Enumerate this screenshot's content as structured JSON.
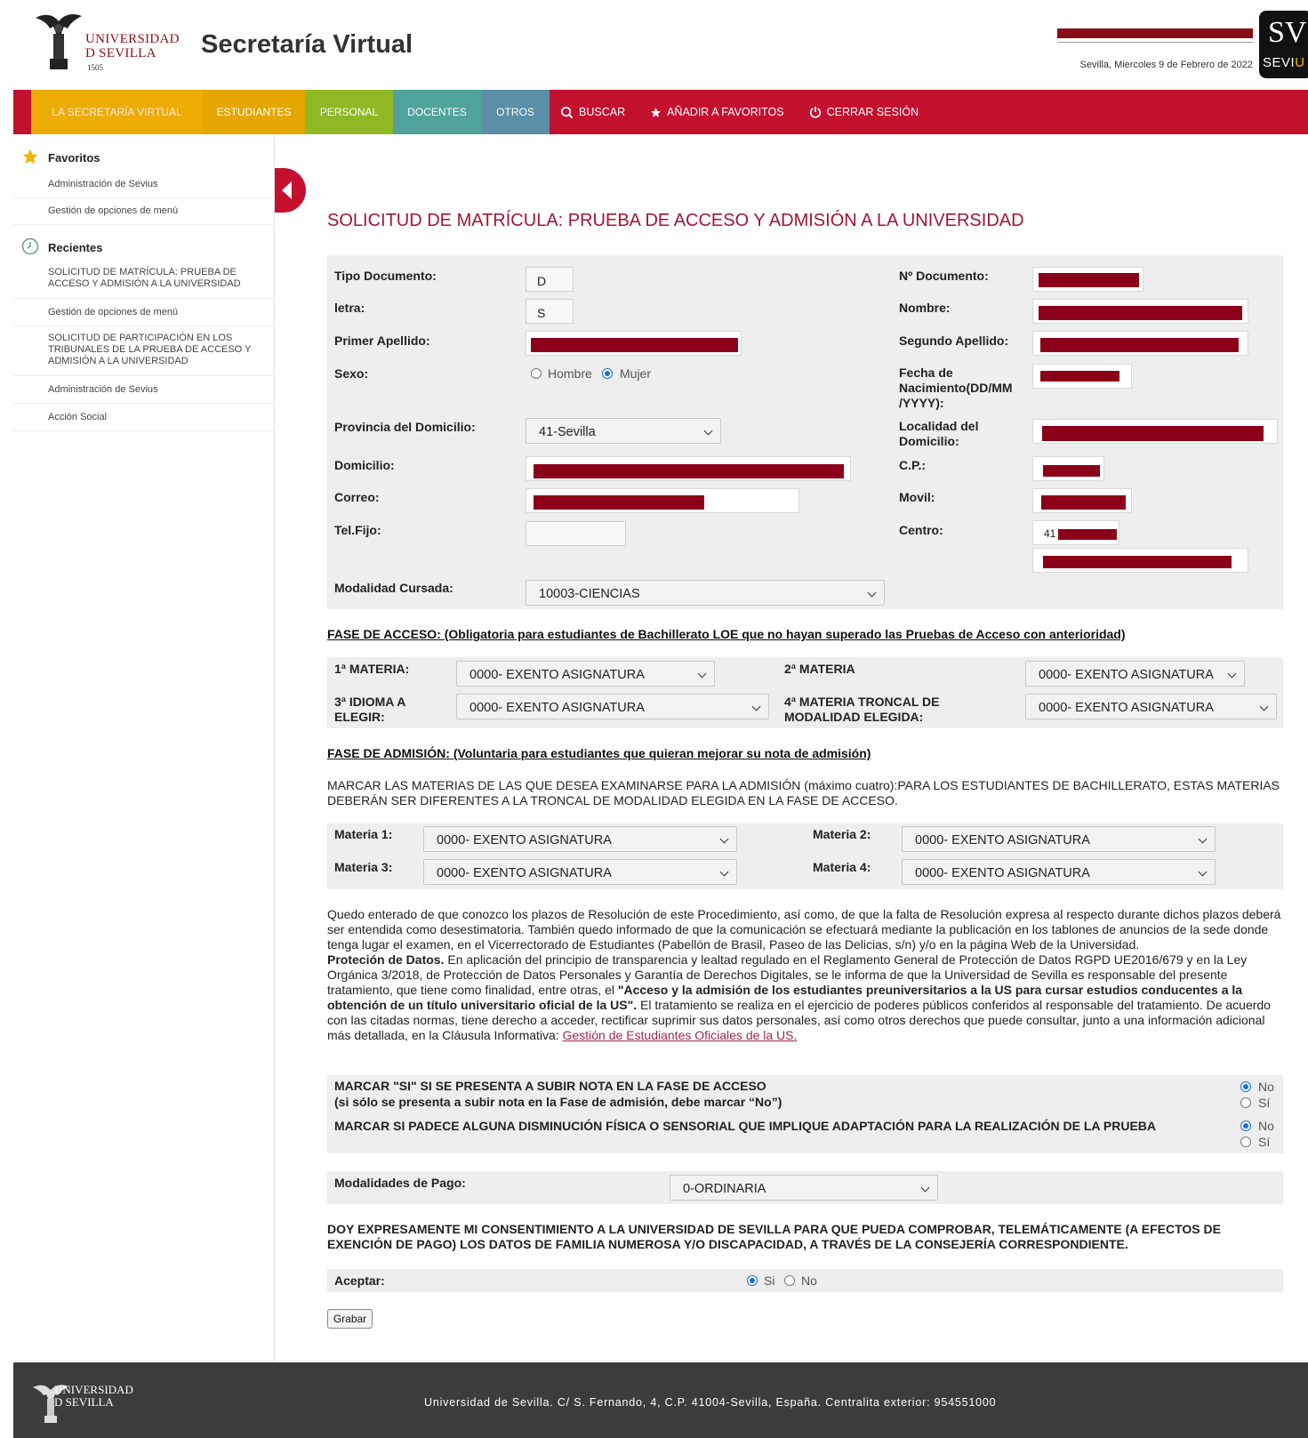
{
  "header": {
    "logo_line1": "UNIVERSIDAD",
    "logo_line2": "D SEVILLA",
    "logo_year": "1505",
    "app_title": "Secretaría Virtual",
    "date": "Sevilla, Miercoles 9 de Febrero de 2022",
    "badge_initials": "SV",
    "badge_word_a": "SEVI",
    "badge_word_b": "U"
  },
  "nav": {
    "tabs": [
      {
        "label": "LA SECRETARÍA VIRTUAL",
        "color": "#f2bd00"
      },
      {
        "label": "ESTUDIANTES",
        "color": "#e5a600"
      },
      {
        "label": "PERSONAL",
        "color": "#8fb824"
      },
      {
        "label": "DOCENTES",
        "color": "#50a39b"
      },
      {
        "label": "OTROS",
        "color": "#5b8ea7"
      }
    ],
    "search": "BUSCAR",
    "favorite": "AÑADIR A FAVORITOS",
    "logout": "CERRAR SESIÓN"
  },
  "sidebar": {
    "favorites_title": "Favoritos",
    "favorites": [
      "Administración de Sevius",
      "Gestión de opciones de menú"
    ],
    "recent_title": "Recientes",
    "recent": [
      "SOLICITUD DE MATRÍCULA: PRUEBA DE ACCESO Y ADMISIÓN A LA UNIVERSIDAD",
      "Gestión de opciones de menú",
      "SOLICITUD DE PARTICIPACIÓN EN LOS TRIBUNALES DE LA PRUEBA DE ACCESO Y ADMISIÓN A LA UNIVERSIDAD",
      "Administración de Sevius",
      "Acción Social"
    ]
  },
  "form": {
    "title": "SOLICITUD DE MATRÍCULA: PRUEBA DE ACCESO Y ADMISIÓN A LA UNIVERSIDAD",
    "labels": {
      "tipo_doc": "Tipo Documento:",
      "letra": "letra:",
      "primer_apellido": "Primer Apellido:",
      "sexo": "Sexo:",
      "provincia": "Provincia del Domicilio:",
      "domicilio": "Domicilio:",
      "correo": "Correo:",
      "telfijo": "Tel.Fijo:",
      "n_doc": "Nº Documento:",
      "nombre": "Nombre:",
      "segundo_apellido": "Segundo Apellido:",
      "fecha_nac": "Fecha de Nacimiento(DD/MM /YYYY):",
      "localidad": "Localidad del Domicilio:",
      "cp": "C.P.:",
      "movil": "Movil:",
      "centro": "Centro:",
      "modalidad": "Modalidad Cursada:"
    },
    "values": {
      "tipo_doc": "D",
      "letra": "S",
      "provincia": "41-Sevilla",
      "centro_prefix": "41",
      "modalidad": "10003-CIENCIAS"
    },
    "sexo_options": [
      "Hombre",
      "Mujer"
    ],
    "sexo_selected": "Mujer"
  },
  "acceso": {
    "heading": "FASE DE ACCESO: (Obligatoria para estudiantes de Bachillerato LOE que no hayan superado las Pruebas de Acceso con anterioridad)",
    "labels": [
      "1ª MATERIA:",
      "2ª MATERIA",
      "3ª IDIOMA A ELEGIR:",
      "4ª MATERIA TRONCAL DE MODALIDAD ELEGIDA:"
    ],
    "values": [
      "0000- EXENTO ASIGNATURA",
      "0000- EXENTO ASIGNATURA",
      "0000- EXENTO ASIGNATURA",
      "0000- EXENTO ASIGNATURA"
    ]
  },
  "admision": {
    "heading": "FASE DE ADMISIÓN: (Voluntaria para estudiantes que quieran mejorar su nota de admisión)",
    "instructions": "MARCAR LAS MATERIAS DE LAS QUE DESEA EXAMINARSE PARA LA ADMISIÓN (máximo cuatro):PARA LOS ESTUDIANTES DE BACHILLERATO, ESTAS MATERIAS DEBERÁN SER DIFERENTES A LA TRONCAL DE MODALIDAD ELEGIDA EN LA FASE DE ACCESO.",
    "labels": [
      "Materia 1:",
      "Materia 2:",
      "Materia 3:",
      "Materia 4:"
    ],
    "values": [
      "0000- EXENTO ASIGNATURA",
      "0000- EXENTO ASIGNATURA",
      "0000- EXENTO ASIGNATURA",
      "0000- EXENTO ASIGNATURA"
    ]
  },
  "legal": {
    "p1": "Quedo enterado de que conozco los plazos de Resolución de este Procedimiento, así como, de que la falta de Resolución expresa al respecto durante dichos plazos deberá ser entendida como desestimatoria. También quedo informado de que la comunicación se efectuará mediante la publicación en los tablones de anuncios de la sede donde tenga lugar el examen, en el Vicerrectorado de Estudiantes (Pabellón de Brasil, Paseo de las Delicias, s/n) y/o en la página Web de la Universidad.",
    "p2_bold": "Proteción de Datos.",
    "p2_a": " En aplicación del principio de transparencia y lealtad regulado en el Reglamento General de Protección de Datos RGPD UE2016/679 y en la Ley Orgánica 3/2018, de Protección de Datos Personales y Garantía de Derechos Digitales, se le informa de que la Universidad de Sevilla es responsable del presente tratamiento, que tiene como finalidad, entre otras, el ",
    "p2_bold2": "\"Acceso y la admisión de los estudiantes preuniversitarios a la US para cursar estudios conducentes a la obtención de un título universitario oficial de la US\".",
    "p2_b": " El tratamiento se realiza en el ejercicio de poderes públicos conferidos al responsable del tratamiento. De acuerdo con las citadas normas, tiene derecho a acceder, rectificar suprimir sus datos personales, así como otros derechos que puede consultar, junto a una información adicional más detallada, en la Cláusula Informativa: ",
    "link": "Gestión de Estudiantes Oficiales de la US."
  },
  "questions": {
    "q1": "MARCAR \"SI\" SI SE PRESENTA A SUBIR NOTA EN LA FASE DE ACCESO",
    "q1_sub": "(si sólo se presenta a subir nota en la Fase de admisión, debe marcar “No”)",
    "q2": "MARCAR SI PADECE ALGUNA DISMINUCIÓN FÍSICA O SENSORIAL QUE IMPLIQUE ADAPTACIÓN PARA LA REALIZACIÓN DE LA PRUEBA",
    "no": "No",
    "si": "Sí",
    "q1_selected": "No",
    "q2_selected": "No"
  },
  "pago": {
    "label": "Modalidades de Pago:",
    "value": "0-ORDINARIA"
  },
  "consent": {
    "text": "DOY EXPRESAMENTE MI CONSENTIMIENTO A LA UNIVERSIDAD DE SEVILLA PARA QUE PUEDA COMPROBAR, TELEMÁTICAMENTE (A EFECTOS DE EXENCIÓN DE PAGO) LOS DATOS DE FAMILIA NUMEROSA Y/O DISCAPACIDAD, A TRAVÉS DE LA CONSEJERÍA CORRESPONDIENTE.",
    "label": "Aceptar:",
    "si": "Si",
    "no": "No",
    "selected": "Si"
  },
  "save_label": "Grabar",
  "footer": {
    "logo_line1": "UNIVERSIDAD",
    "logo_line2": "D SEVILLA",
    "address": "Universidad de Sevilla. C/ S. Fernando, 4, C.P. 41004-Sevilla, España. Centralita exterior: 954551000"
  }
}
